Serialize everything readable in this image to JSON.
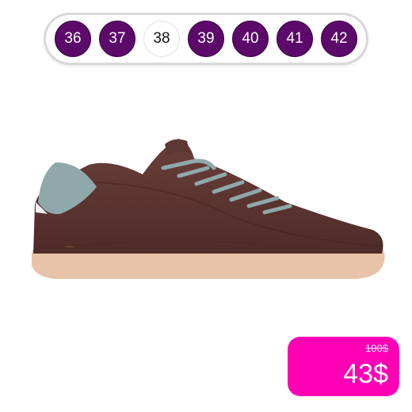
{
  "size_selector": {
    "sizes": [
      "36",
      "37",
      "38",
      "39",
      "40",
      "41",
      "42"
    ],
    "selected": "38"
  },
  "product": {
    "image_icon": "sneaker-image",
    "colors": {
      "upper": "#5a3430",
      "heel_accent": "#8fa9ab",
      "laces": "#8fa9ab",
      "sole": "#e8c3a9"
    }
  },
  "price": {
    "old": "100$",
    "current": "43$",
    "badge_color": "#ff00b4"
  }
}
